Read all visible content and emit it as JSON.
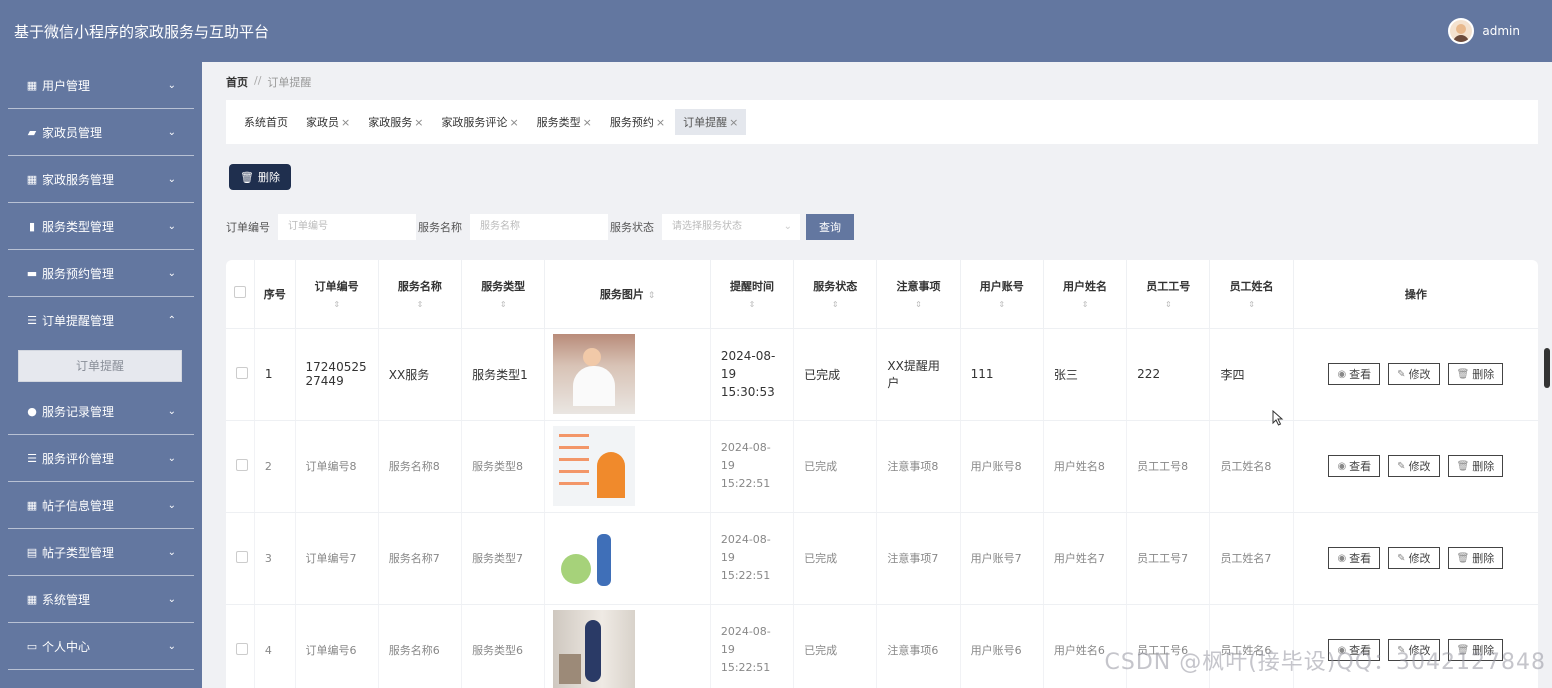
{
  "header": {
    "title": "基于微信小程序的家政服务与互助平台",
    "username": "admin"
  },
  "sidebar": {
    "items": [
      {
        "label": "用户管理",
        "icon": "▦"
      },
      {
        "label": "家政员管理",
        "icon": "▰"
      },
      {
        "label": "家政服务管理",
        "icon": "▦"
      },
      {
        "label": "服务类型管理",
        "icon": "▮"
      },
      {
        "label": "服务预约管理",
        "icon": "▬"
      },
      {
        "label": "订单提醒管理",
        "icon": "☰"
      },
      {
        "label": "服务记录管理",
        "icon": "●"
      },
      {
        "label": "服务评价管理",
        "icon": "☰"
      },
      {
        "label": "帖子信息管理",
        "icon": "▦"
      },
      {
        "label": "帖子类型管理",
        "icon": "▤"
      },
      {
        "label": "系统管理",
        "icon": "▦"
      },
      {
        "label": "个人中心",
        "icon": "▭"
      }
    ],
    "submenu_active": "订单提醒"
  },
  "breadcrumb": {
    "home": "首页",
    "sep": "//",
    "current": "订单提醒"
  },
  "tabs": [
    "系统首页",
    "家政员",
    "家政服务",
    "家政服务评论",
    "服务类型",
    "服务预约",
    "订单提醒"
  ],
  "tab_close": "×",
  "toolbar": {
    "delete_label": "删除"
  },
  "search": {
    "order_label": "订单编号",
    "order_placeholder": "订单编号",
    "name_label": "服务名称",
    "name_placeholder": "服务名称",
    "status_label": "服务状态",
    "status_placeholder": "请选择服务状态",
    "query_label": "查询"
  },
  "table": {
    "headers": [
      "序号",
      "订单编号",
      "服务名称",
      "服务类型",
      "服务图片",
      "提醒时间",
      "服务状态",
      "注意事项",
      "用户账号",
      "用户姓名",
      "员工工号",
      "员工姓名",
      "操作"
    ],
    "rows": [
      [
        "1",
        "1724052527449",
        "XX服务",
        "服务类型1",
        "",
        "2024-08-19 15:30:53",
        "已完成",
        "XX提醒用户",
        "111",
        "张三",
        "222",
        "李四"
      ],
      [
        "2",
        "订单编号8",
        "服务名称8",
        "服务类型8",
        "",
        "2024-08-19 15:22:51",
        "已完成",
        "注意事项8",
        "用户账号8",
        "用户姓名8",
        "员工工号8",
        "员工姓名8"
      ],
      [
        "3",
        "订单编号7",
        "服务名称7",
        "服务类型7",
        "",
        "2024-08-19 15:22:51",
        "已完成",
        "注意事项7",
        "用户账号7",
        "用户姓名7",
        "员工工号7",
        "员工姓名7"
      ],
      [
        "4",
        "订单编号6",
        "服务名称6",
        "服务类型6",
        "",
        "2024-08-19 15:22:51",
        "已完成",
        "注意事项6",
        "用户账号6",
        "用户姓名6",
        "员工工号6",
        "员工姓名6"
      ]
    ],
    "ops": {
      "view": "查看",
      "edit": "修改",
      "delete": "删除"
    },
    "sort_glyph": "⇕"
  },
  "watermark": "CSDN @枫叶(接毕设)QQ：3042127848"
}
